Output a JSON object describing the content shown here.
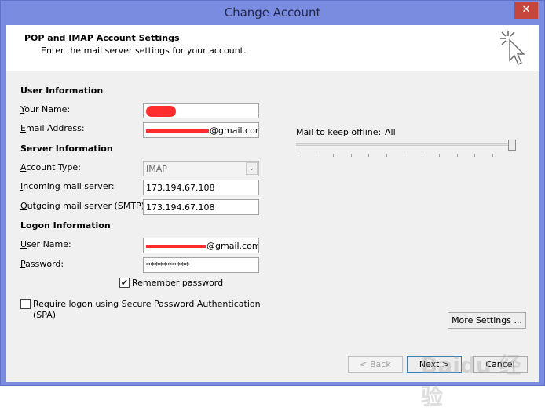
{
  "window": {
    "title": "Change Account",
    "close_glyph": "✕"
  },
  "header": {
    "title": "POP and IMAP Account Settings",
    "subtitle": "Enter the mail server settings for your account."
  },
  "user_info": {
    "heading": "User Information",
    "name_label": "Your Name:",
    "email_label": "Email Address:",
    "email_value_suffix": "@gmail.com"
  },
  "server_info": {
    "heading": "Server Information",
    "account_type_label": "Account Type:",
    "account_type_value": "IMAP",
    "incoming_label": "Incoming mail server:",
    "incoming_value": "173.194.67.108",
    "outgoing_label": "Outgoing mail server (SMTP):",
    "outgoing_value": "173.194.67.108"
  },
  "logon_info": {
    "heading": "Logon Information",
    "username_label": "User Name:",
    "username_value_suffix": "@gmail.com",
    "password_label": "Password:",
    "password_value": "**********",
    "remember_label": "Remember password",
    "remember_checked": true,
    "spa_label": "Require logon using Secure Password Authentication",
    "spa_label_line2": "(SPA)",
    "spa_checked": false
  },
  "offline": {
    "label": "Mail to keep offline:",
    "value": "All",
    "level": 1.0
  },
  "buttons": {
    "more_settings": "More Settings ...",
    "back": "< Back",
    "next": "Next >",
    "cancel": "Cancel"
  },
  "watermark": "Baidu 经验",
  "icons": {
    "checkmark": "✔",
    "combo_arrow": "⌄",
    "wizard": "cursor-sparkle-icon"
  }
}
